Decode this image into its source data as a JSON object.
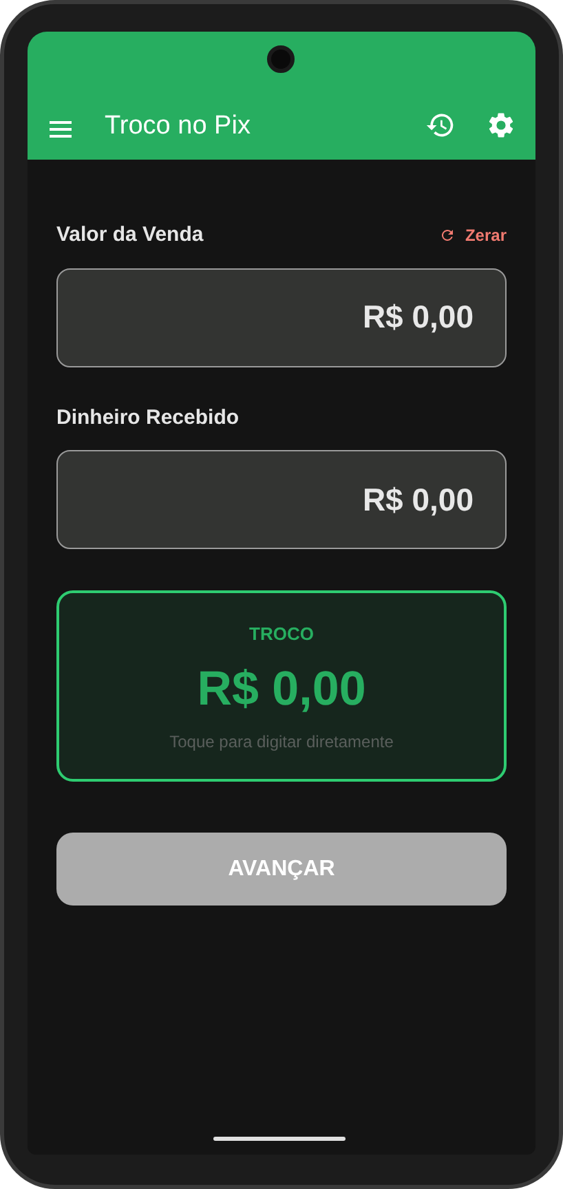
{
  "app_bar": {
    "title": "Troco no Pix"
  },
  "fields": [
    {
      "label": "Valor da Venda",
      "value": "R$ 0,00",
      "action": "Zerar"
    },
    {
      "label": "Dinheiro Recebido",
      "value": "R$ 0,00"
    }
  ],
  "change_card": {
    "label": "TROCO",
    "value": "R$ 0,00",
    "hint": "Toque para digitar diretamente"
  },
  "primary_button": {
    "label": "AVANÇAR",
    "disabled": true
  }
}
